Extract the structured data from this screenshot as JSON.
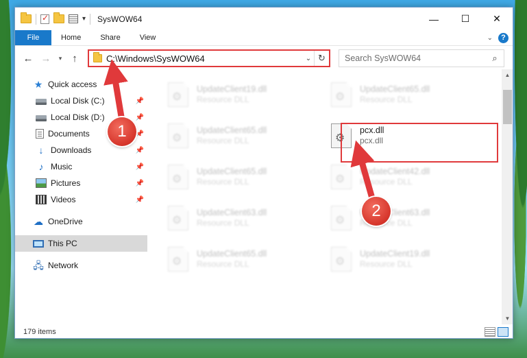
{
  "window": {
    "title": "SysWOW64",
    "controls": {
      "minimize": "—",
      "maximize": "☐",
      "close": "✕"
    }
  },
  "ribbon": {
    "tabs": [
      "File",
      "Home",
      "Share",
      "View"
    ]
  },
  "navigation": {
    "back": "←",
    "forward": "→",
    "recent": "▾",
    "up": "↑",
    "address": "C:\\Windows\\SysWOW64",
    "search_placeholder": "Search SysWOW64"
  },
  "sidebar": {
    "items": [
      {
        "label": "Quick access",
        "icon": "star-icon",
        "pinned": false
      },
      {
        "label": "Local Disk (C:)",
        "icon": "drive-icon",
        "pinned": true
      },
      {
        "label": "Local Disk (D:)",
        "icon": "drive-icon",
        "pinned": true
      },
      {
        "label": "Documents",
        "icon": "documents-icon",
        "pinned": true
      },
      {
        "label": "Downloads",
        "icon": "downloads-icon",
        "pinned": true
      },
      {
        "label": "Music",
        "icon": "music-icon",
        "pinned": true
      },
      {
        "label": "Pictures",
        "icon": "pictures-icon",
        "pinned": true
      },
      {
        "label": "Videos",
        "icon": "videos-icon",
        "pinned": true
      },
      {
        "label": "OneDrive",
        "icon": "onedrive-icon",
        "pinned": false
      },
      {
        "label": "This PC",
        "icon": "this-pc-icon",
        "pinned": false,
        "selected": true
      },
      {
        "label": "Network",
        "icon": "network-icon",
        "pinned": false
      }
    ]
  },
  "files": [
    {
      "name": "UpdateClient19.dll",
      "type": "Resource DLL",
      "blurred": true
    },
    {
      "name": "UpdateClient65.dll",
      "type": "Resource DLL",
      "blurred": true
    },
    {
      "name": "UpdateClient65.dll",
      "type": "Resource DLL",
      "blurred": true
    },
    {
      "name": "pcx.dll",
      "type": "pcx.dll",
      "blurred": false
    },
    {
      "name": "UpdateClient65.dll",
      "type": "Resource DLL",
      "blurred": true
    },
    {
      "name": "UpdateClient42.dll",
      "type": "Resource DLL",
      "blurred": true
    },
    {
      "name": "UpdateClient63.dll",
      "type": "Resource DLL",
      "blurred": true
    },
    {
      "name": "UpdateClient63.dll",
      "type": "Resource DLL",
      "blurred": true
    },
    {
      "name": "UpdateClient65.dll",
      "type": "Resource DLL",
      "blurred": true
    },
    {
      "name": "UpdateClient19.dll",
      "type": "Resource DLL",
      "blurred": true
    }
  ],
  "status": {
    "items_count": "179 items"
  },
  "annotations": {
    "step1": "1",
    "step2": "2"
  },
  "colors": {
    "accent": "#1979ca",
    "highlight": "#e0393b"
  }
}
